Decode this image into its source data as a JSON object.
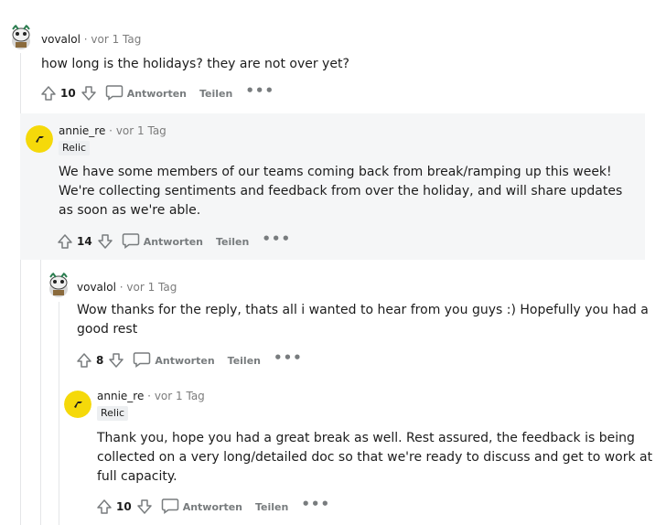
{
  "comments": [
    {
      "username": "vovalol",
      "separator": "·",
      "time": "vor 1 Tag",
      "flair": "",
      "body": "how long is the holidays? they are not over yet?",
      "score": "10",
      "reply_label": "Antworten",
      "share_label": "Teilen",
      "more_label": "•••",
      "avatar_icon": "snoo-avatar-icon"
    },
    {
      "username": "annie_re",
      "separator": "·",
      "time": "vor 1 Tag",
      "flair": "Relic",
      "body": "We have some members of our teams coming back from break/ramping up this week! We're collecting sentiments and feedback from over the holiday, and will share updates as soon as we're able.",
      "score": "14",
      "reply_label": "Antworten",
      "share_label": "Teilen",
      "more_label": "•••",
      "avatar_icon": "relic-logo-icon"
    },
    {
      "username": "vovalol",
      "separator": "·",
      "time": "vor 1 Tag",
      "flair": "",
      "body": "Wow thanks for the reply, thats all i wanted to hear from you guys :) Hopefully you had a good rest",
      "score": "8",
      "reply_label": "Antworten",
      "share_label": "Teilen",
      "more_label": "•••",
      "avatar_icon": "snoo-avatar-icon"
    },
    {
      "username": "annie_re",
      "separator": "·",
      "time": "vor 1 Tag",
      "flair": "Relic",
      "body": "Thank you, hope you had a great break as well. Rest assured, the feedback is being collected on a very long/detailed doc so that we're ready to discuss and get to work at full capacity.",
      "score": "10",
      "reply_label": "Antworten",
      "share_label": "Teilen",
      "more_label": "•••",
      "avatar_icon": "relic-logo-icon"
    }
  ],
  "colors": {
    "highlight_bg": "#f5f6f7",
    "relic_yellow": "#f5d90a",
    "action_gray": "#787c7e",
    "thread_line": "#e4e6e8"
  }
}
